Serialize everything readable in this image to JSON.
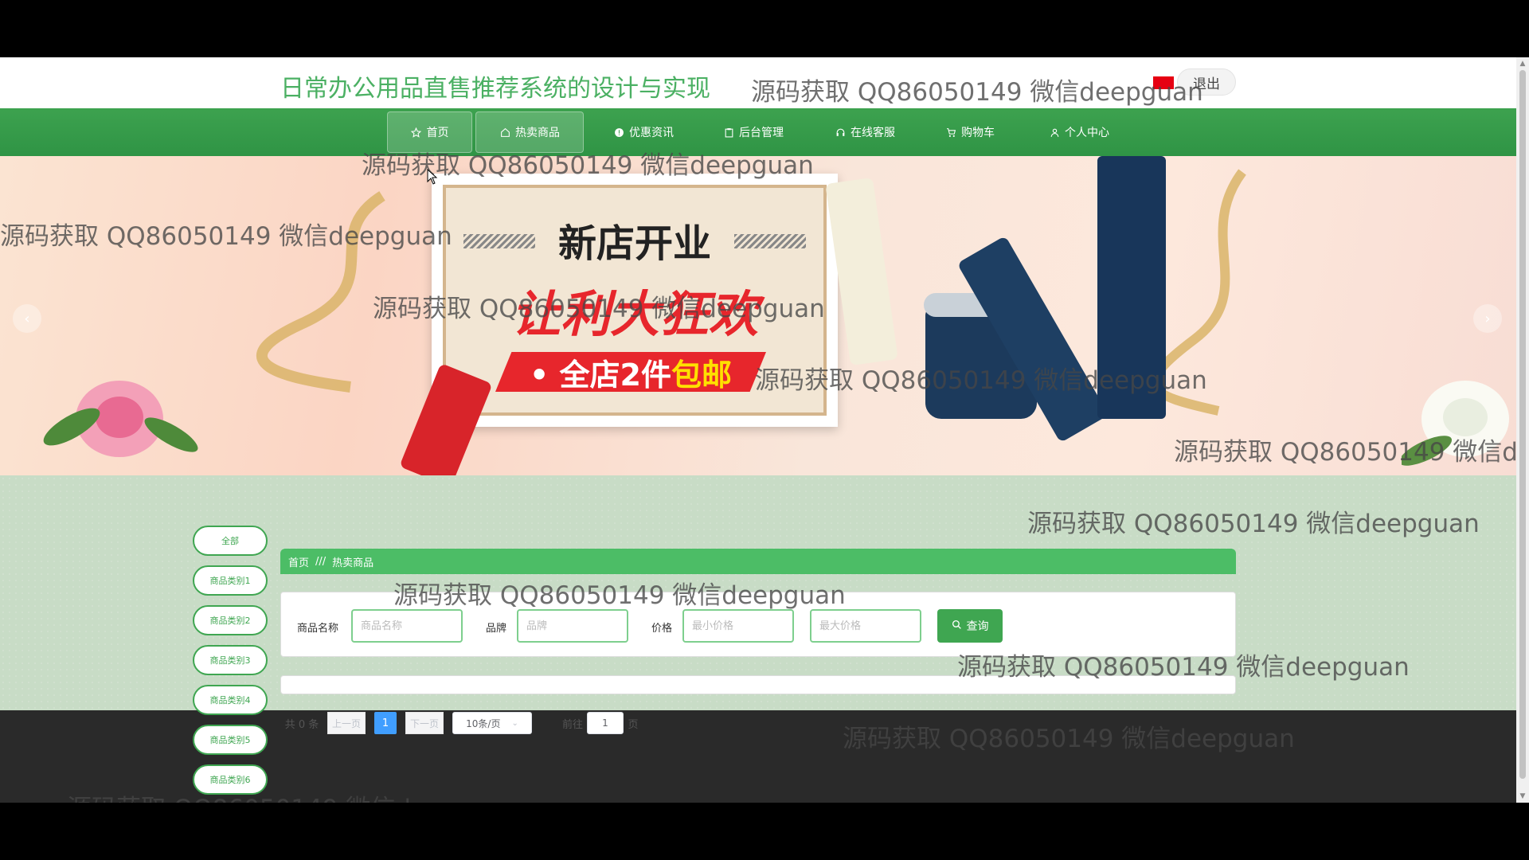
{
  "header": {
    "site_title": "日常办公用品直售推荐系统的设计与实现",
    "logout_label": "退出"
  },
  "nav": {
    "items": [
      {
        "label": "首页",
        "icon": "star-icon"
      },
      {
        "label": "热卖商品",
        "icon": "home-icon"
      },
      {
        "label": "优惠资讯",
        "icon": "info-icon"
      },
      {
        "label": "后台管理",
        "icon": "clipboard-icon"
      },
      {
        "label": "在线客服",
        "icon": "headset-icon"
      },
      {
        "label": "购物车",
        "icon": "cart-icon"
      },
      {
        "label": "个人中心",
        "icon": "user-icon"
      }
    ]
  },
  "banner": {
    "line1": "新店开业",
    "line2": "让利大狂欢",
    "ribbon_prefix": "• 全店2件",
    "ribbon_highlight": "包邮",
    "prev_icon": "chevron-left-icon",
    "next_icon": "chevron-right-icon"
  },
  "breadcrumb": {
    "home": "首页",
    "separator": "///",
    "current": "热卖商品"
  },
  "categories": [
    "全部",
    "商品类别1",
    "商品类别2",
    "商品类别3",
    "商品类别4",
    "商品类别5",
    "商品类别6"
  ],
  "search": {
    "name_label": "商品名称",
    "name_placeholder": "商品名称",
    "brand_label": "品牌",
    "brand_placeholder": "品牌",
    "price_label": "价格",
    "min_price_placeholder": "最小价格",
    "max_price_placeholder": "最大价格",
    "button_label": "查询"
  },
  "pagination": {
    "total": "共 0 条",
    "prev": "上一页",
    "current_page": "1",
    "next": "下一页",
    "page_size": "10条/页",
    "goto_prefix": "前往",
    "goto_value": "1",
    "goto_suffix": "页"
  },
  "watermark": "源码获取 QQ86050149 微信deepguan",
  "colors": {
    "brand_green": "#3fa651",
    "title_green": "#4bb063",
    "breadcrumb_green": "#4cbd66",
    "pager_blue": "#409eff",
    "footer": "#2a2a2a"
  }
}
